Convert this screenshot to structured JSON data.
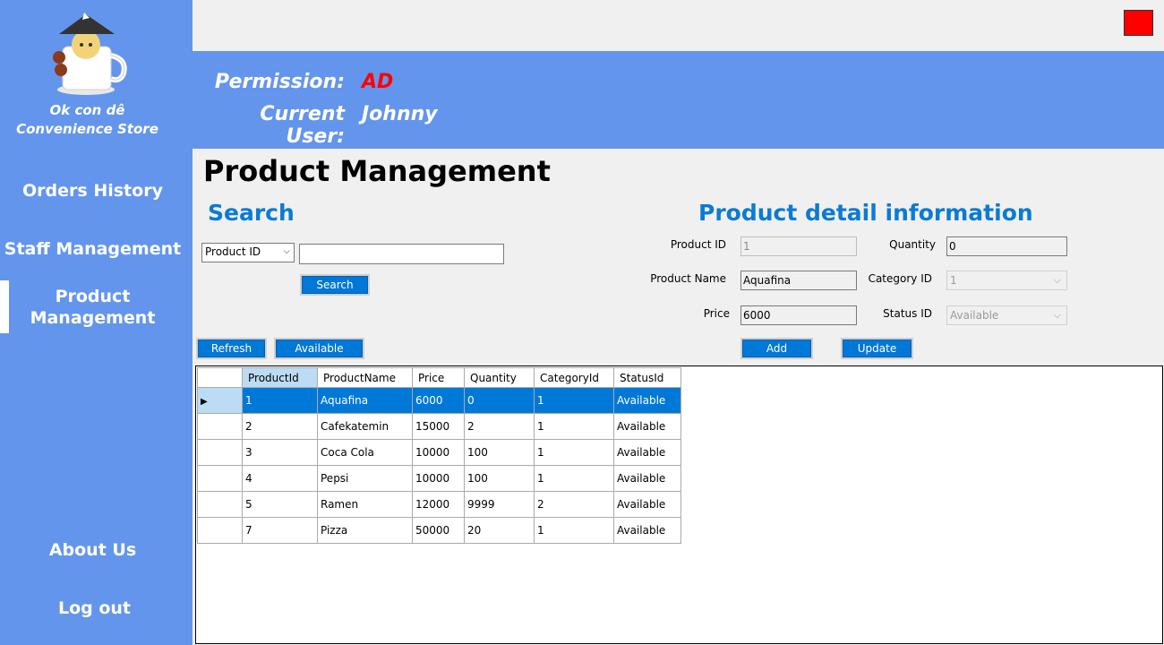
{
  "sidebar": {
    "store_name_line1": "Ok con dê",
    "store_name_line2": "Convenience Store",
    "nav": {
      "orders": "Orders History",
      "staff": "Staff Management",
      "product_line1": "Product",
      "product_line2": "Management",
      "about": "About Us",
      "logout": "Log out"
    }
  },
  "header": {
    "permission_label": "Permission:",
    "permission_value": "AD",
    "user_label": "Current User:",
    "user_value": "Johnny"
  },
  "page_title": "Product Management",
  "search": {
    "title": "Search",
    "filter_selected": "Product ID",
    "input_value": "",
    "button": "Search"
  },
  "detail": {
    "title": "Product detail information",
    "product_id_label": "Product ID",
    "product_id_value": "1",
    "quantity_label": "Quantity",
    "quantity_value": "0",
    "product_name_label": "Product Name",
    "product_name_value": "Aquafina",
    "category_label": "Category ID",
    "category_value": "1",
    "price_label": "Price",
    "price_value": "6000",
    "status_label": "Status ID",
    "status_value": "Available",
    "add_button": "Add",
    "update_button": "Update"
  },
  "actions": {
    "refresh": "Refresh",
    "available": "Available"
  },
  "grid": {
    "columns": [
      "ProductId",
      "ProductName",
      "Price",
      "Quantity",
      "CategoryId",
      "StatusId"
    ],
    "rows": [
      [
        "1",
        "Aquafina",
        "6000",
        "0",
        "1",
        "Available"
      ],
      [
        "2",
        "Cafekatemin",
        "15000",
        "2",
        "1",
        "Available"
      ],
      [
        "3",
        "Coca Cola",
        "10000",
        "100",
        "1",
        "Available"
      ],
      [
        "4",
        "Pepsi",
        "10000",
        "100",
        "1",
        "Available"
      ],
      [
        "5",
        "Ramen",
        "12000",
        "9999",
        "2",
        "Available"
      ],
      [
        "7",
        "Pizza",
        "50000",
        "20",
        "1",
        "Available"
      ]
    ]
  },
  "colors": {
    "sidebar": "#6495ed",
    "accent": "#0078d7",
    "section_title": "#0a7bd4",
    "permission": "#ff0000",
    "close": "#ff0000"
  }
}
